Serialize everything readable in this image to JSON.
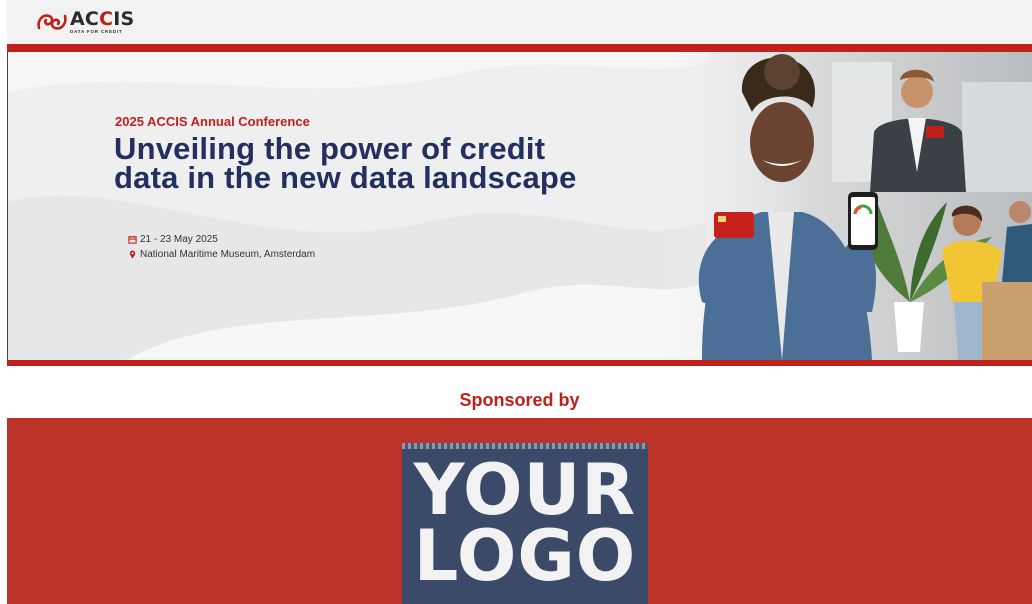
{
  "header": {
    "logo_name_1": "AC",
    "logo_name_red": "C",
    "logo_name_2": "IS",
    "logo_tagline": "DATA FOR CREDIT"
  },
  "hero": {
    "eyebrow": "2025 ACCIS Annual Conference",
    "headline": "Unveiling the power of credit data in the new data landscape",
    "date": "21 - 23 May 2025",
    "venue": "National Maritime Museum, Amsterdam"
  },
  "sponsors": {
    "heading": "Sponsored by",
    "logo_text": "YOUR LOGO"
  },
  "colors": {
    "brand_red": "#c1211b",
    "navy": "#23305f",
    "sponsor_band": "#bc3329"
  },
  "icons": [
    "calendar-icon",
    "map-pin-icon",
    "accis-logo-mark"
  ]
}
